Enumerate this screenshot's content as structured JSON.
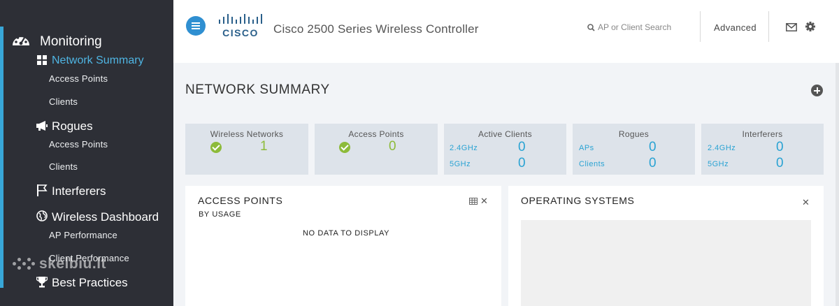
{
  "header": {
    "app_title": "Cisco 2500 Series Wireless Controller",
    "logo_text": "CISCO",
    "search_placeholder": "AP or Client Search",
    "advanced_label": "Advanced"
  },
  "sidebar": {
    "monitoring": "Monitoring",
    "network_summary": "Network Summary",
    "access_points": "Access Points",
    "clients": "Clients",
    "rogues": "Rogues",
    "rogue_access_points": "Access Points",
    "rogue_clients": "Clients",
    "interferers": "Interferers",
    "wireless_dashboard": "Wireless Dashboard",
    "ap_performance": "AP Performance",
    "client_performance": "Client Performance",
    "best_practices": "Best Practices",
    "watermark": "skelbiu.lt"
  },
  "main": {
    "page_title": "NETWORK SUMMARY",
    "tiles": {
      "wireless_networks": {
        "label": "Wireless Networks",
        "value": "1"
      },
      "access_points": {
        "label": "Access Points",
        "value": "0"
      },
      "active_clients": {
        "label": "Active Clients",
        "band1": "2.4GHz",
        "value1": "0",
        "band2": "5GHz",
        "value2": "0"
      },
      "rogues": {
        "label": "Rogues",
        "row1": "APs",
        "value1": "0",
        "row2": "Clients",
        "value2": "0"
      },
      "interferers": {
        "label": "Interferers",
        "band1": "2.4GHz",
        "value1": "0",
        "band2": "5GHz",
        "value2": "0"
      }
    },
    "access_points_panel": {
      "title": "ACCESS POINTS",
      "subtitle": "BY USAGE",
      "empty_text": "NO DATA TO DISPLAY"
    },
    "os_panel": {
      "title": "OPERATING SYSTEMS"
    }
  },
  "colors": {
    "sidebar_bg": "#2d2f36",
    "accent": "#38a7d8",
    "ok_green": "#8dbb3a",
    "value_blue": "#2aa3d3",
    "tile_bg": "#dde3ea"
  },
  "icons": [
    "dashboard-icon",
    "grid-icon",
    "megaphone-icon",
    "flag-icon",
    "globe-icon",
    "trophy-icon",
    "menu-icon",
    "search-icon",
    "mail-icon",
    "gear-icon",
    "plus-circle-icon",
    "table-icon",
    "close-icon",
    "check-circle-icon"
  ]
}
